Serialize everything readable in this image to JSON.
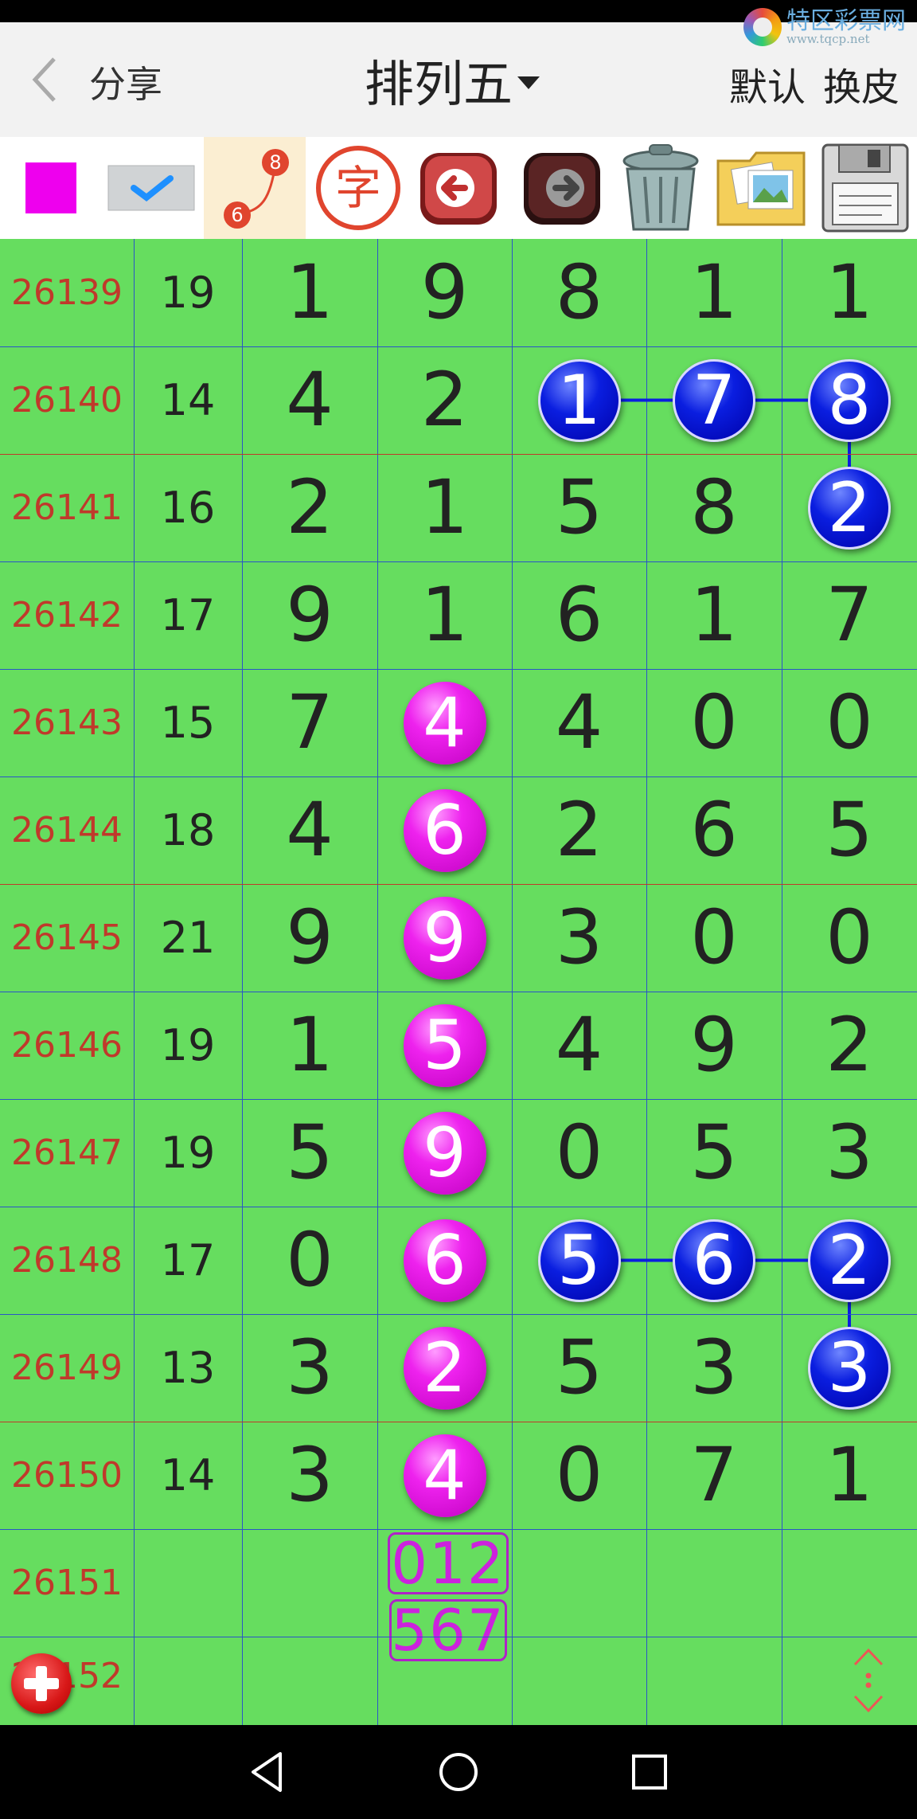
{
  "watermark": {
    "name": "特区彩票网",
    "url": "www.tqcp.net"
  },
  "header": {
    "back_icon": "chevron-left-icon",
    "share": "分享",
    "title": "排列五",
    "default": "默认",
    "skin": "换皮"
  },
  "toolbar": {
    "color_swatch": "#ee00ee",
    "trend_icon_numbers": {
      "top": "8",
      "bottom": "6"
    },
    "char_icon_text": "字"
  },
  "rows": [
    {
      "issue": "26140",
      "sum": "14",
      "digits": [
        "4",
        "2",
        "1",
        "7",
        "8"
      ]
    },
    {
      "issue": "26141",
      "sum": "16",
      "digits": [
        "2",
        "1",
        "5",
        "8",
        "2"
      ]
    },
    {
      "issue": "26142",
      "sum": "17",
      "digits": [
        "9",
        "1",
        "6",
        "1",
        "7"
      ]
    },
    {
      "issue": "26143",
      "sum": "15",
      "digits": [
        "7",
        "4",
        "4",
        "0",
        "0"
      ]
    },
    {
      "issue": "26144",
      "sum": "18",
      "digits": [
        "4",
        "6",
        "2",
        "6",
        "5"
      ]
    },
    {
      "issue": "26145",
      "sum": "21",
      "digits": [
        "9",
        "9",
        "3",
        "0",
        "0"
      ]
    },
    {
      "issue": "26146",
      "sum": "19",
      "digits": [
        "1",
        "5",
        "4",
        "9",
        "2"
      ]
    },
    {
      "issue": "26147",
      "sum": "19",
      "digits": [
        "5",
        "9",
        "0",
        "5",
        "3"
      ]
    },
    {
      "issue": "26148",
      "sum": "17",
      "digits": [
        "0",
        "6",
        "5",
        "6",
        "2"
      ]
    },
    {
      "issue": "26149",
      "sum": "13",
      "digits": [
        "3",
        "2",
        "5",
        "3",
        "3"
      ]
    },
    {
      "issue": "26150",
      "sum": "14",
      "digits": [
        "3",
        "4",
        "0",
        "7",
        "1"
      ]
    }
  ],
  "top_row": {
    "issue": "26139",
    "sum": "19",
    "digits": [
      "1",
      "9",
      "8",
      "1",
      "1"
    ]
  },
  "prediction_row": {
    "issue": "26151",
    "line1": "012",
    "line2": "567"
  },
  "partial_row": {
    "issue": "26152"
  },
  "highlights": {
    "magenta_color": "#ee22ee",
    "blue_color": "#0a1ee0"
  }
}
